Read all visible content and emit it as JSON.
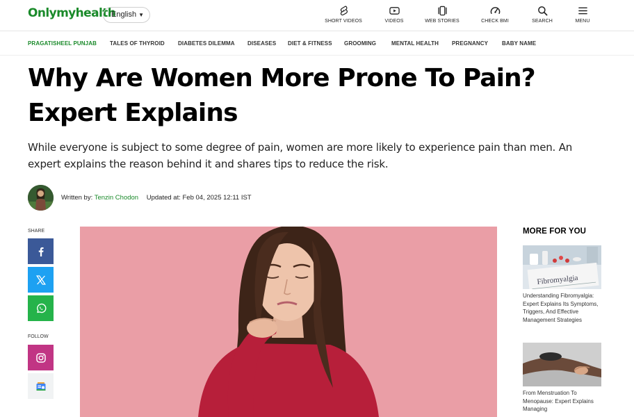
{
  "header": {
    "logo": "Onlymyhealth",
    "language": "English",
    "nav": [
      {
        "label": "SHORT VIDEOS",
        "icon": "shorts-icon"
      },
      {
        "label": "VIDEOS",
        "icon": "play-icon"
      },
      {
        "label": "WEB STORIES",
        "icon": "web-stories-icon"
      },
      {
        "label": "CHECK BMI",
        "icon": "gauge-icon"
      },
      {
        "label": "SEARCH",
        "icon": "search-icon"
      },
      {
        "label": "MENU",
        "icon": "hamburger-icon"
      }
    ]
  },
  "categories": [
    "PRAGATISHEEL PUNJAB",
    "TALES OF THYROID",
    "DIABETES DILEMMA",
    "DISEASES",
    "DIET & FITNESS",
    "GROOMING",
    "MENTAL HEALTH",
    "PREGNANCY",
    "BABY NAME"
  ],
  "colors": {
    "brand_green": "#1a8a2a",
    "facebook": "#3b5998",
    "twitter": "#1da1f2",
    "whatsapp": "#25b34a",
    "instagram": "#c13584",
    "hero_bg": "#ea9ea6"
  },
  "article": {
    "title_line1": "Why Are Women More Prone To Pain?",
    "title_line2": "Expert Explains",
    "summary": "While everyone is subject to some degree of pain, women are more likely to experience pain than men. An expert explains the reason behind it and shares tips to reduce the risk.",
    "written_by_label": "Written by:",
    "author": "Tenzin Chodon",
    "updated": "Updated at: Feb 04, 2025 12:11 IST"
  },
  "share": {
    "share_label": "SHARE",
    "follow_label": "FOLLOW"
  },
  "sidebar": {
    "heading": "MORE FOR YOU",
    "items": [
      {
        "title": "Understanding Fibromyalgia: Expert Explains Its Symptoms, Triggers, And Effective Management Strategies",
        "image_text": "Fibromyalgia"
      },
      {
        "title": "From Menstruation To Menopause: Expert Explains Managing"
      }
    ]
  }
}
